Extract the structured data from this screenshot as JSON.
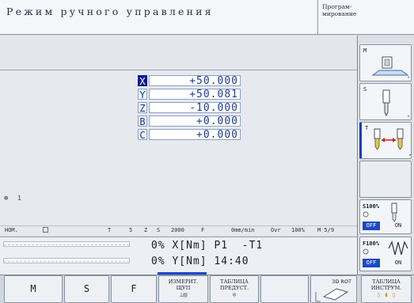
{
  "header": {
    "mode_title": "Режим ручного управления",
    "program_mode_line1": "Програм-",
    "program_mode_line2": "мирование"
  },
  "positions": [
    {
      "axis": "X",
      "value": "+50.000",
      "active": true
    },
    {
      "axis": "Y",
      "value": "+50.081",
      "active": false
    },
    {
      "axis": "Z",
      "value": "-10.000",
      "active": false
    },
    {
      "axis": "B",
      "value": "+0.000",
      "active": false
    },
    {
      "axis": "C",
      "value": "+0.000",
      "active": false
    }
  ],
  "status_area": {
    "icon": "spindle-icon",
    "count": "1"
  },
  "status_bar": {
    "mode": "НОМ.",
    "tool_label": "T",
    "tool_value": "5",
    "axis_label": "Z",
    "spindle_label": "S",
    "spindle_value": "2000",
    "feed_label": "F",
    "feed_value": "0mm/min",
    "override_label": "Ovr",
    "override_value": "100%",
    "m_functions": "M 5/9"
  },
  "lower_readout": {
    "line1": "0% X[Nm] P1  -T1",
    "line2": "0% Y[Nm] 14:40"
  },
  "right_softkeys": [
    {
      "label": "M",
      "icon": "screen-machine-icon"
    },
    {
      "label": "S",
      "icon": "spindle-tool-icon"
    },
    {
      "label": "T",
      "icon": "tool-change-icon"
    }
  ],
  "overrides": {
    "spindle": {
      "label": "S100%",
      "off": "OFF",
      "on": "ON"
    },
    "feed": {
      "label": "F100%",
      "off": "OFF",
      "on": "ON"
    }
  },
  "bottom_softkeys": {
    "m": "M",
    "s": "S",
    "f": "F",
    "probe_line1": "ИЗМЕРИТ.",
    "probe_line2": "ЩУП",
    "preset_line1": "ТАБЛИЦА",
    "preset_line2": "ПРЕДУСТ.",
    "rot3d": "3D ROT",
    "tools_line1": "ТАБЛИЦА",
    "tools_line2": "ИНСТРУМ."
  },
  "colors": {
    "accent": "#1d48c8",
    "axis_text": "#1c3f92",
    "active_axis_bg": "#0d1a8c"
  }
}
